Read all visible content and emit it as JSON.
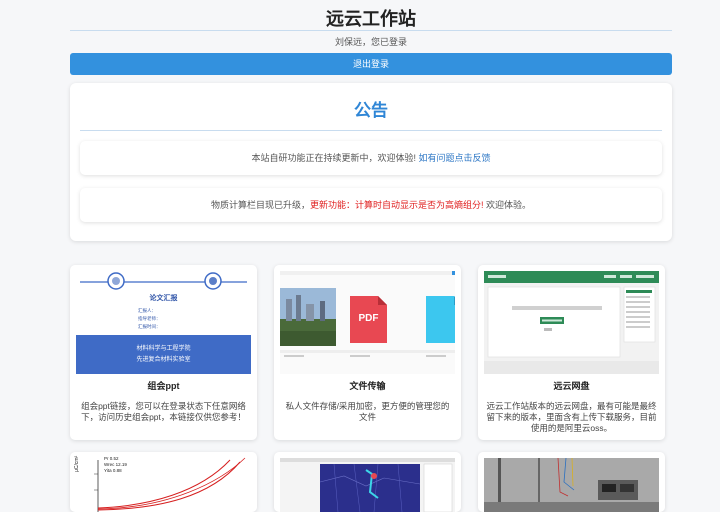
{
  "header": {
    "site_title": "远云工作站",
    "login_status": "刘保远，您已登录",
    "logout_label": "退出登录"
  },
  "notice": {
    "title": "公告",
    "item1_text": "本站自研功能正在持续更新中，欢迎体验!",
    "item1_link": "如有问题点击反馈",
    "item2_text_a": "物质计算栏目现已升级，",
    "item2_text_red": "更新功能：计算时自动显示是否为高熵组分!",
    "item2_text_b": " 欢迎体验。"
  },
  "cards": [
    {
      "title": "组会ppt",
      "desc": "组会ppt链接，您可以在登录状态下任意网络下，访问历史组会ppt，本链接仅供您参考！",
      "thumb": {
        "heading": "论文汇报",
        "line1": "汇报人：",
        "line2": "指导老师：",
        "line3": "汇报时间：",
        "banner1": "材料科学与工程学院",
        "banner2": "先进复合材料实验室"
      }
    },
    {
      "title": "文件传输",
      "desc": "私人文件存储/采用加密，更方便的管理您的文件",
      "thumb": {
        "pdf_label": "PDF"
      }
    },
    {
      "title": "远云网盘",
      "desc": "远云工作站版本的远云网盘，最有可能是最终留下来的版本，里面含有上传下载服务，目前使用的是阿里云oss。",
      "thumb": {}
    }
  ],
  "bottom_cards": [
    {
      "legend1": "Pr   0.52",
      "legend2": "Wrec  12.19",
      "legend3": "Yita  0.88",
      "axis_label": "μC/cm²"
    },
    {},
    {}
  ],
  "colors": {
    "accent": "#3391de",
    "notice_title": "#2f86d6",
    "link": "#2f78c6",
    "alert_red": "#e02020",
    "ppt_banner": "#3f6bc6",
    "pdf_red": "#e84852",
    "file_cyan": "#3cc7ef"
  }
}
